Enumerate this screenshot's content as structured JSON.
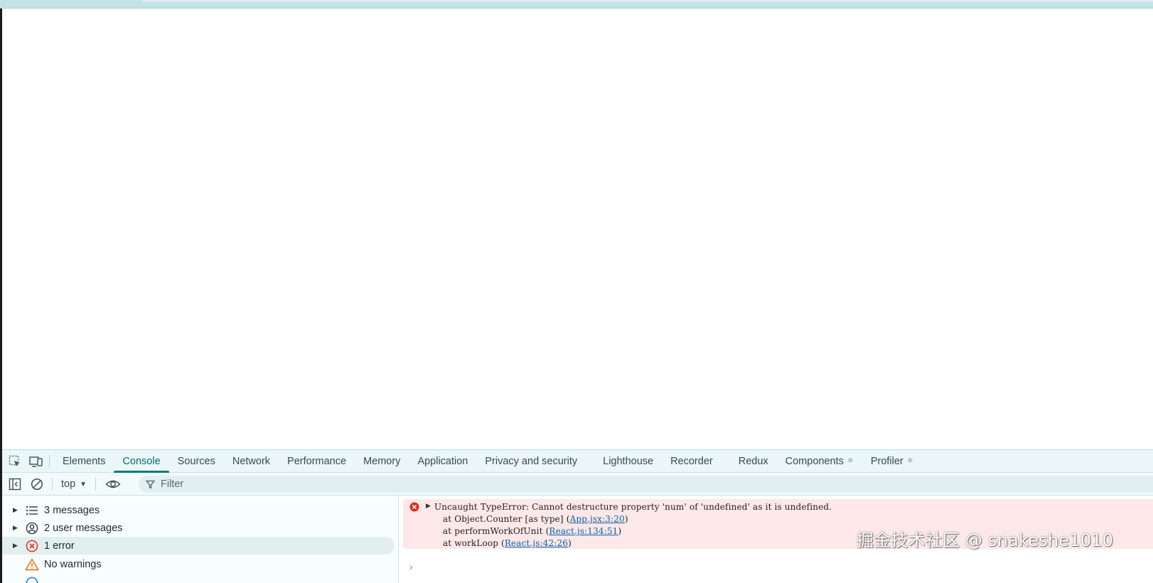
{
  "colors": {
    "accent": "#0b7b7b",
    "error_background": "#fce8e8",
    "error_icon": "#d93025",
    "warning_icon": "#e8710a",
    "link": "#0a5ea8"
  },
  "devtools": {
    "tabbar": {
      "icons": [
        "select-element-icon",
        "device-toolbar-icon"
      ],
      "tabs": [
        {
          "label": "Elements"
        },
        {
          "label": "Console",
          "active": true
        },
        {
          "label": "Sources"
        },
        {
          "label": "Network"
        },
        {
          "label": "Performance"
        },
        {
          "label": "Memory"
        },
        {
          "label": "Application"
        },
        {
          "label": "Privacy and security"
        },
        {
          "label": "Lighthouse"
        },
        {
          "label": "Recorder"
        },
        {
          "label": "Redux"
        },
        {
          "label": "Components",
          "icon": "gear-icon"
        },
        {
          "label": "Profiler",
          "icon": "gear-icon"
        }
      ]
    },
    "toolbar": {
      "context": "top",
      "filter_placeholder": "Filter"
    },
    "sidebar": {
      "items": [
        {
          "label": "3 messages",
          "icon": "list-icon"
        },
        {
          "label": "2 user messages",
          "icon": "user-circle-icon"
        },
        {
          "label": "1 error",
          "icon": "error-circle-icon",
          "selected": true
        },
        {
          "label": "No warnings",
          "icon": "warning-triangle-icon"
        }
      ]
    },
    "console": {
      "error": {
        "message": "Uncaught TypeError: Cannot destructure property 'num' of 'undefined' as it is undefined.",
        "stack": [
          {
            "prefix": "at Object.Counter [as type] (",
            "link": "App.jsx:3:20",
            "suffix": ")"
          },
          {
            "prefix": "at performWorkOfUnit (",
            "link": "React.js:134:51",
            "suffix": ")"
          },
          {
            "prefix": "at workLoop (",
            "link": "React.js:42:26",
            "suffix": ")"
          }
        ]
      },
      "prompt_symbol": "›"
    }
  },
  "watermark": "掘金技术社区 @ snakeshe1010"
}
